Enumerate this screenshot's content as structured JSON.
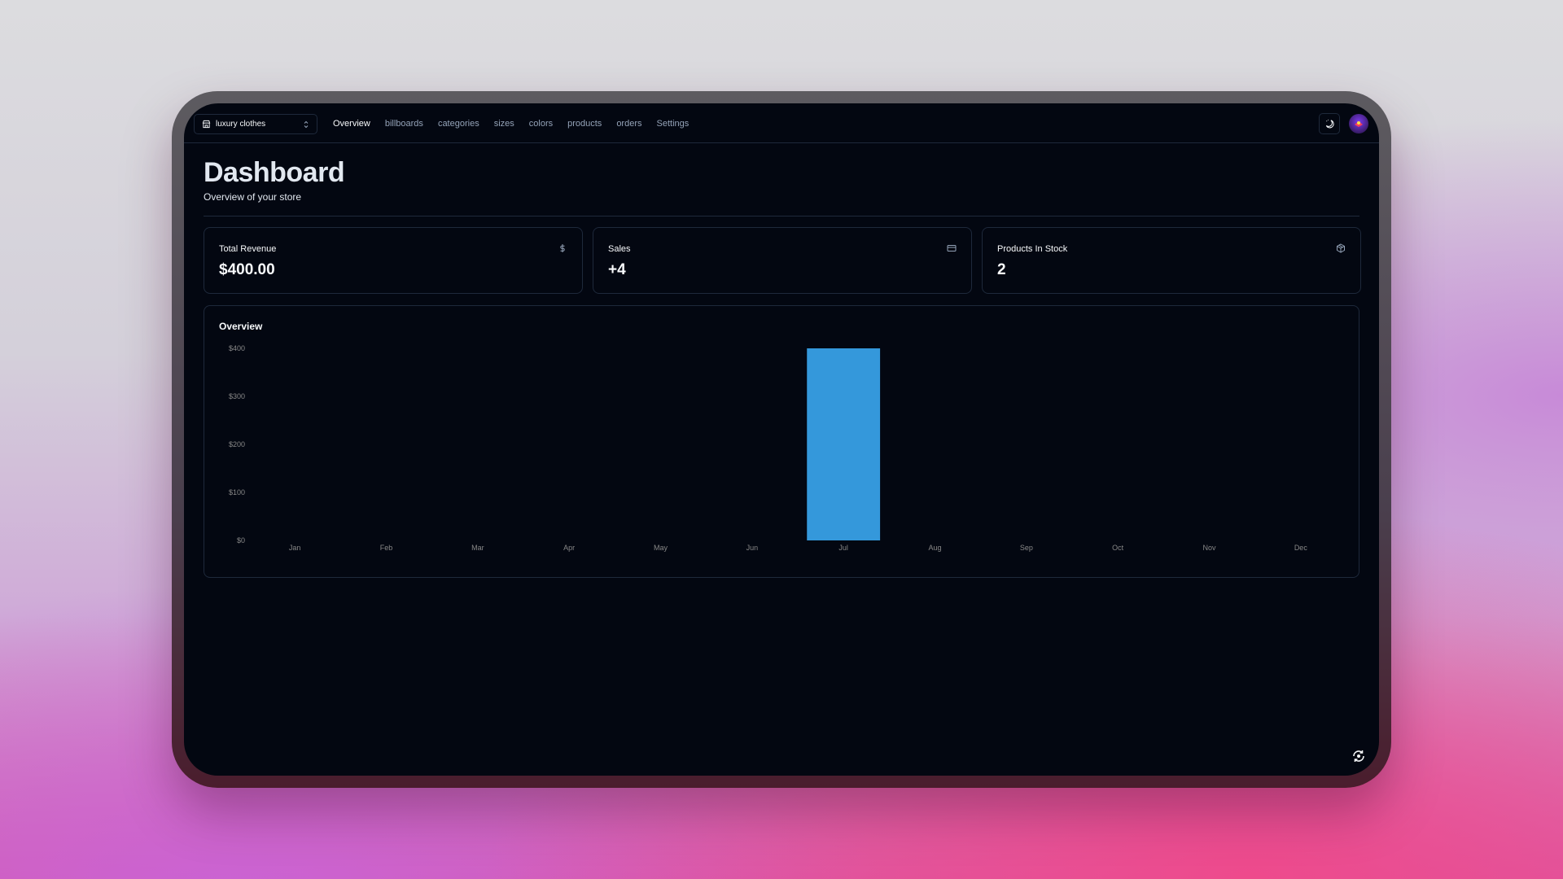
{
  "store_switcher": {
    "label": "luxury clothes",
    "icon": "store-icon"
  },
  "nav": {
    "links": [
      {
        "label": "Overview",
        "active": true
      },
      {
        "label": "billboards",
        "active": false
      },
      {
        "label": "categories",
        "active": false
      },
      {
        "label": "sizes",
        "active": false
      },
      {
        "label": "colors",
        "active": false
      },
      {
        "label": "products",
        "active": false
      },
      {
        "label": "orders",
        "active": false
      },
      {
        "label": "Settings",
        "active": false
      }
    ],
    "theme_toggle_icon": "moon-icon",
    "avatar_icon": "user-avatar"
  },
  "header": {
    "title": "Dashboard",
    "subtitle": "Overview of your store"
  },
  "cards": [
    {
      "title": "Total Revenue",
      "value": "$400.00",
      "icon": "dollar-icon"
    },
    {
      "title": "Sales",
      "value": "+4",
      "icon": "credit-card-icon"
    },
    {
      "title": "Products In Stock",
      "value": "2",
      "icon": "package-icon"
    }
  ],
  "overview": {
    "title": "Overview"
  },
  "chart_data": {
    "type": "bar",
    "title": "Overview",
    "categories": [
      "Jan",
      "Feb",
      "Mar",
      "Apr",
      "May",
      "Jun",
      "Jul",
      "Aug",
      "Sep",
      "Oct",
      "Nov",
      "Dec"
    ],
    "values": [
      0,
      0,
      0,
      0,
      0,
      0,
      400,
      0,
      0,
      0,
      0,
      0
    ],
    "yticks": [
      "$0",
      "$100",
      "$200",
      "$300",
      "$400"
    ],
    "ylim": [
      0,
      400
    ],
    "grid": false,
    "bar_color": "#3498db"
  },
  "colors": {
    "background": "#030711",
    "border": "#1e293b",
    "muted_text": "#94a3b8",
    "text": "#f8fafc",
    "accent": "#3498db"
  },
  "corner_button_icon": "sync-icon"
}
